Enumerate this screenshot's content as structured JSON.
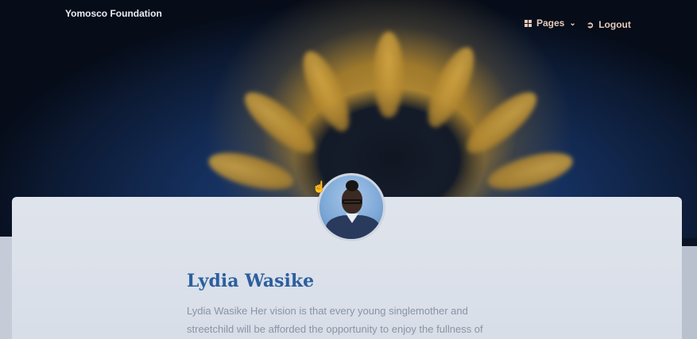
{
  "navbar": {
    "brand": "Yomosco Foundation",
    "pages_label": "Pages",
    "logout_label": "Logout"
  },
  "profile": {
    "name": "Lydia Wasike",
    "bio_line1": "Lydia Wasike Her vision is that every young singlemother and",
    "bio_line2": "streetchild will be afforded the opportunity to enjoy the fullness of"
  },
  "icons": {
    "pages": "grid-icon",
    "pages_dropdown": "chevron-down-icon",
    "logout": "sign-out-icon",
    "cursor": "hand-pointer-icon"
  },
  "colors": {
    "name_color": "#2c5f9e",
    "nav_text": "#e6c9b9",
    "bio_text": "#8a93a4"
  }
}
